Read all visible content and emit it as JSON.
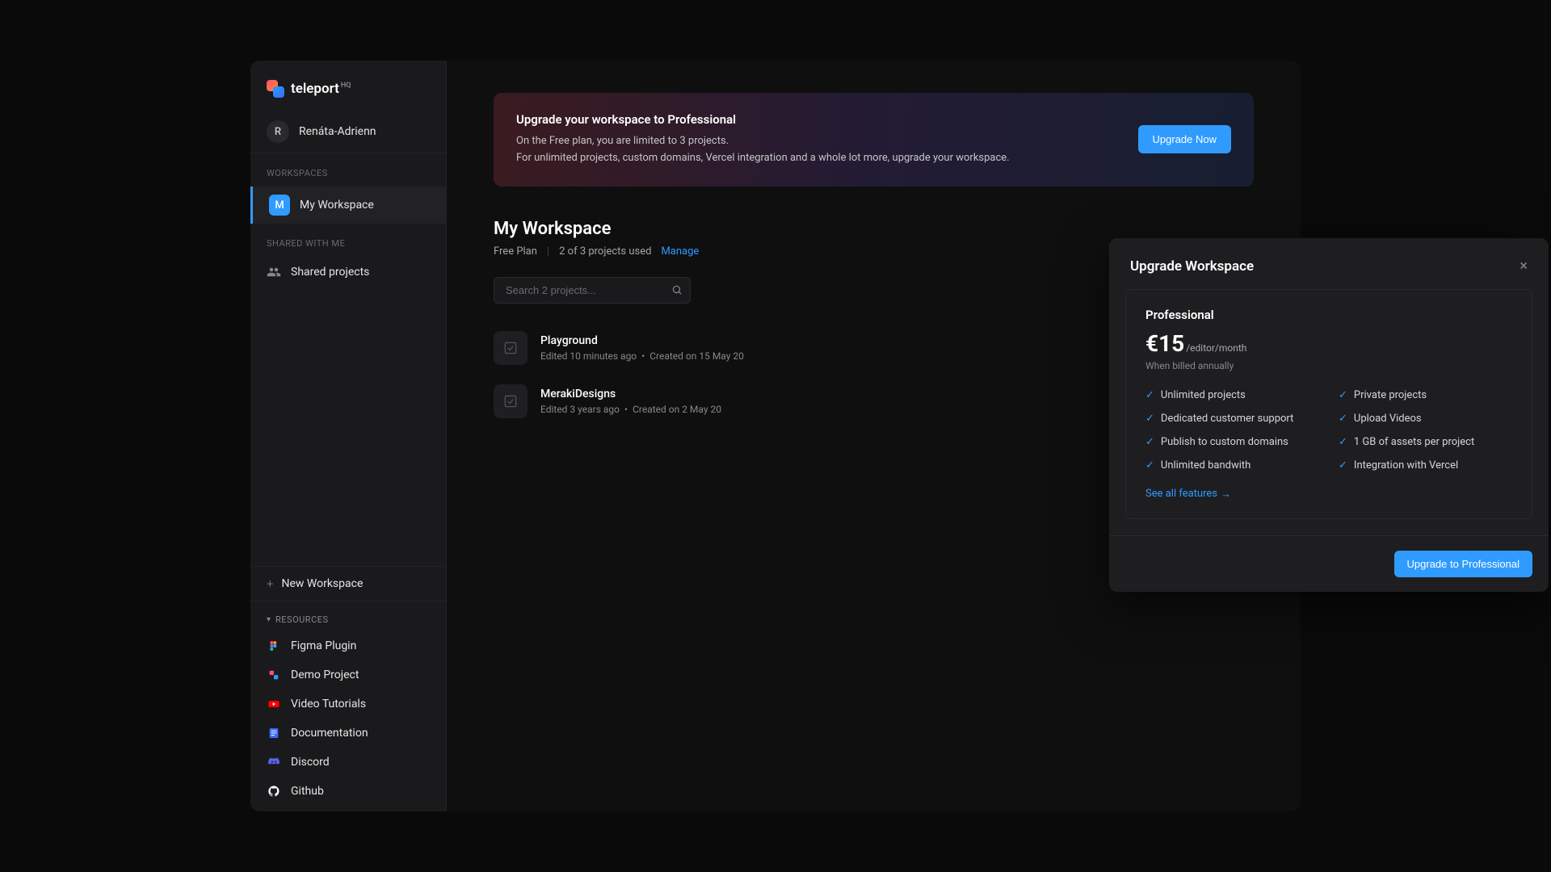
{
  "brand": {
    "name": "teleport",
    "suffix": "HQ"
  },
  "user": {
    "initial": "R",
    "name": "Renáta-Adrienn"
  },
  "sidebar": {
    "workspaces_label": "WORKSPACES",
    "workspace": {
      "initial": "M",
      "name": "My Workspace"
    },
    "shared_label": "SHARED WITH ME",
    "shared_item": "Shared projects",
    "new_workspace": "New Workspace",
    "resources_label": "RESOURCES",
    "resources": [
      {
        "label": "Figma Plugin"
      },
      {
        "label": "Demo Project"
      },
      {
        "label": "Video Tutorials"
      },
      {
        "label": "Documentation"
      },
      {
        "label": "Discord"
      },
      {
        "label": "Github"
      }
    ]
  },
  "banner": {
    "title": "Upgrade your workspace to Professional",
    "line1": "On the Free plan, you are limited to 3 projects.",
    "line2": "For unlimited projects, custom domains, Vercel integration and a whole lot more, upgrade your workspace.",
    "button": "Upgrade Now"
  },
  "workspace": {
    "title": "My Workspace",
    "plan": "Free Plan",
    "usage": "2 of 3 projects used",
    "manage": "Manage"
  },
  "search": {
    "placeholder": "Search 2 projects..."
  },
  "projects": [
    {
      "name": "Playground",
      "edited": "Edited 10 minutes ago",
      "created": "Created on 15 May 20"
    },
    {
      "name": "MerakiDesigns",
      "edited": "Edited 3 years ago",
      "created": "Created on 2 May 20"
    }
  ],
  "modal": {
    "title": "Upgrade Workspace",
    "plan_name": "Professional",
    "price": "€15",
    "unit": "/editor/month",
    "billing": "When billed annually",
    "features_left": [
      "Unlimited projects",
      "Dedicated customer support",
      "Publish to custom domains",
      "Unlimited bandwith"
    ],
    "features_right": [
      "Private projects",
      "Upload Videos",
      "1 GB of assets per project",
      "Integration with Vercel"
    ],
    "see_all": "See all features",
    "button": "Upgrade to Professional"
  }
}
